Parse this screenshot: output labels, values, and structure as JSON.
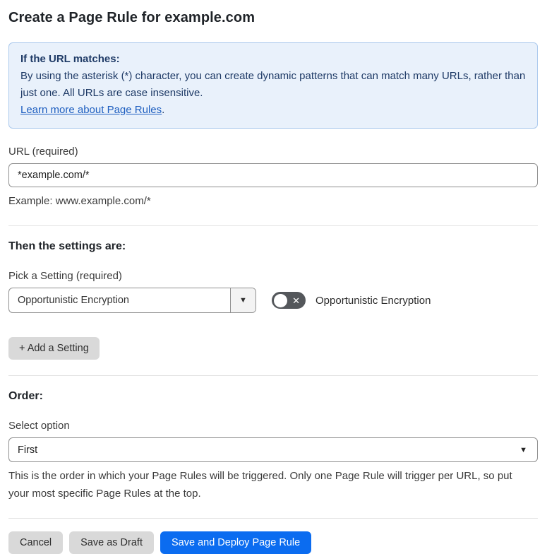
{
  "page": {
    "title": "Create a Page Rule for example.com"
  },
  "info_box": {
    "heading": "If the URL matches:",
    "body": "By using the asterisk (*) character, you can create dynamic patterns that can match many URLs, rather than just one. All URLs are case insensitive.",
    "link_label": "Learn more about Page Rules",
    "link_suffix": "."
  },
  "url_field": {
    "label": "URL (required)",
    "value": "*example.com/*",
    "helper": "Example: www.example.com/*"
  },
  "settings_section": {
    "heading": "Then the settings are:",
    "picker_label": "Pick a Setting (required)",
    "picker_value": "Opportunistic Encryption",
    "toggle_state": "off",
    "toggle_label": "Opportunistic Encryption",
    "add_button_label": "+ Add a Setting"
  },
  "order_section": {
    "heading": "Order:",
    "select_label": "Select option",
    "select_value": "First",
    "helper": "This is the order in which your Page Rules will be triggered. Only one Page Rule will trigger per URL, so put your most specific Page Rules at the top."
  },
  "footer": {
    "cancel_label": "Cancel",
    "save_draft_label": "Save as Draft",
    "save_deploy_label": "Save and Deploy Page Rule"
  },
  "icons": {
    "dropdown_arrow": "▼",
    "toggle_off_x": "✕"
  },
  "colors": {
    "accent_blue": "#0b6cf0",
    "info_bg": "#e9f1fb",
    "info_border": "#abc9ed",
    "info_text": "#1e3a66",
    "link_blue": "#1f5fc0",
    "toggle_off_bg": "#54575b",
    "button_gray": "#d9d9d9"
  }
}
